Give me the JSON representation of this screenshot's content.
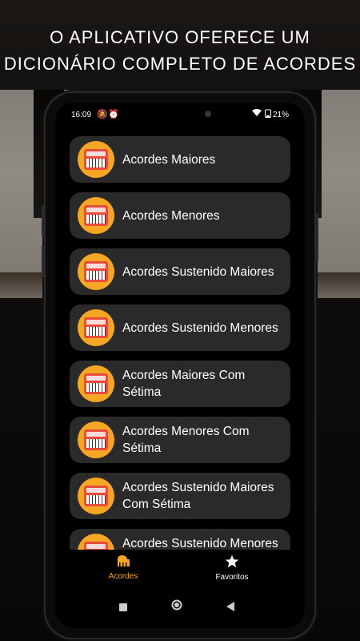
{
  "headline": {
    "line1": "O APLICATIVO OFERECE UM",
    "line2": "DICIONÁRIO COMPLETO DE ACORDES"
  },
  "status": {
    "time": "16:09",
    "battery": "21%"
  },
  "list": [
    {
      "label": "Acordes Maiores",
      "icon": "synthesizer-icon"
    },
    {
      "label": "Acordes Menores",
      "icon": "synthesizer-icon"
    },
    {
      "label": "Acordes Sustenido Maiores",
      "icon": "synthesizer-icon"
    },
    {
      "label": "Acordes Sustenido Menores",
      "icon": "synthesizer-icon"
    },
    {
      "label": "Acordes Maiores Com Sétima",
      "icon": "synthesizer-icon"
    },
    {
      "label": "Acordes Menores Com Sétima",
      "icon": "synthesizer-icon"
    },
    {
      "label": "Acordes Sustenido Maiores Com Sétima",
      "icon": "synthesizer-icon"
    },
    {
      "label": "Acordes Sustenido Menores Com Sétima",
      "icon": "synthesizer-icon"
    }
  ],
  "bottom_nav": {
    "acordes": "Acordes",
    "favoritos": "Favoritos"
  },
  "colors": {
    "accent": "#f5a623",
    "card": "#2a2a2a",
    "synth": "#e74c3c"
  }
}
